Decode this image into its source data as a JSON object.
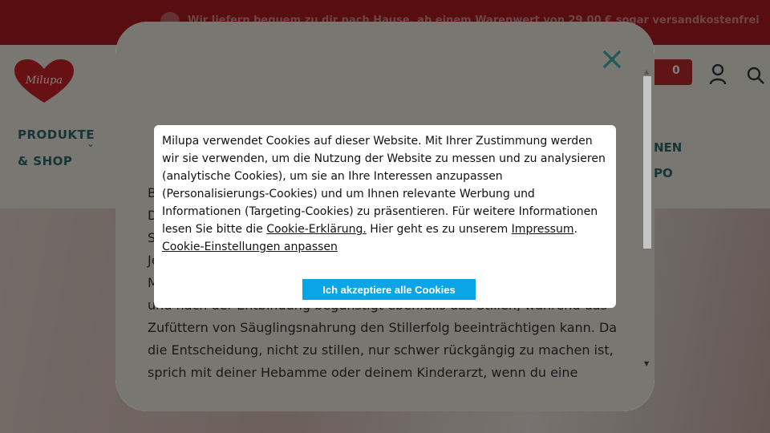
{
  "topbar": {
    "text": "Wir liefern bequem zu dir nach Hause, ab einem Warenwert von 29,00 € sogar versandkostenfrei"
  },
  "header": {
    "logo_text": "Milupa",
    "nav": {
      "produkte_line1": "PRODUKTE",
      "produkte_line2": "& SHOP",
      "right_line1": "NEN",
      "right_line2": "PO"
    },
    "cart_count": "0"
  },
  "modal": {
    "body_lines": [
      "B",
      "D",
      "S",
      "Je",
      "M",
      "und nach der Entbindung begünstigt ebenfalls das Stillen, während das",
      "Zufüttern von Säuglingsnahrung den Stillerfolg beeinträchtigen kann. Da",
      "die Entscheidung, nicht zu stillen, nur schwer rückgängig zu machen ist,",
      "sprich mit deiner Hebamme oder deinem Kinderarzt, wenn du eine"
    ]
  },
  "cookie": {
    "text_part1": "Milupa verwendet Cookies auf dieser Website. Mit Ihrer Zustimmung werden wir sie verwenden, um die Nutzung der Website zu messen und zu analysieren (analytische Cookies), um sie an Ihre Interessen anzupassen (Personalisierungs-Cookies) und um Ihnen relevante Werbung und Informationen (Targeting-Cookies) zu präsentieren. Für weitere Informationen lesen Sie bitte die ",
    "link_cookie_statement": "Cookie-Erklärung.",
    "text_part2": " Hier geht es zu unserem ",
    "link_impressum": "Impressum",
    "text_part3": ".",
    "link_settings": "Cookie-Einstellungen anpassen",
    "accept_label": "Ich akzeptiere alle Cookies"
  },
  "colors": {
    "brand_red": "#b01c22",
    "accent_teal": "#2d6a6a",
    "accept_blue": "#0aa5e6"
  }
}
